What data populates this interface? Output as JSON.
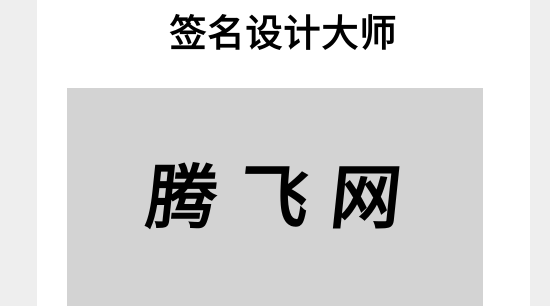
{
  "header": {
    "title": "签名设计大师"
  },
  "signature": {
    "text": "腾飞网",
    "background_color": "#d3d3d3",
    "text_color": "#000000"
  }
}
